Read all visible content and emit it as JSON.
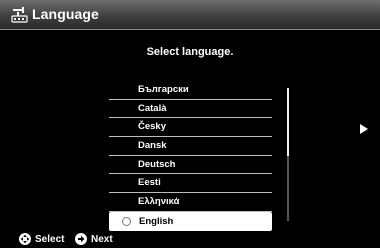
{
  "header": {
    "title": "Language",
    "icon": "tools-icon"
  },
  "prompt": "Select language.",
  "languages": [
    {
      "label": "Български",
      "selected": false
    },
    {
      "label": "Català",
      "selected": false
    },
    {
      "label": "Česky",
      "selected": false
    },
    {
      "label": "Dansk",
      "selected": false
    },
    {
      "label": "Deutsch",
      "selected": false
    },
    {
      "label": "Eesti",
      "selected": false
    },
    {
      "label": "Ελληνικά",
      "selected": false
    },
    {
      "label": "English",
      "selected": true
    }
  ],
  "footer": {
    "select_label": "Select",
    "next_label": "Next"
  },
  "colors": {
    "background": "#000000",
    "text": "#ffffff",
    "selected_bg": "#ffffff",
    "selected_text": "#000000"
  }
}
